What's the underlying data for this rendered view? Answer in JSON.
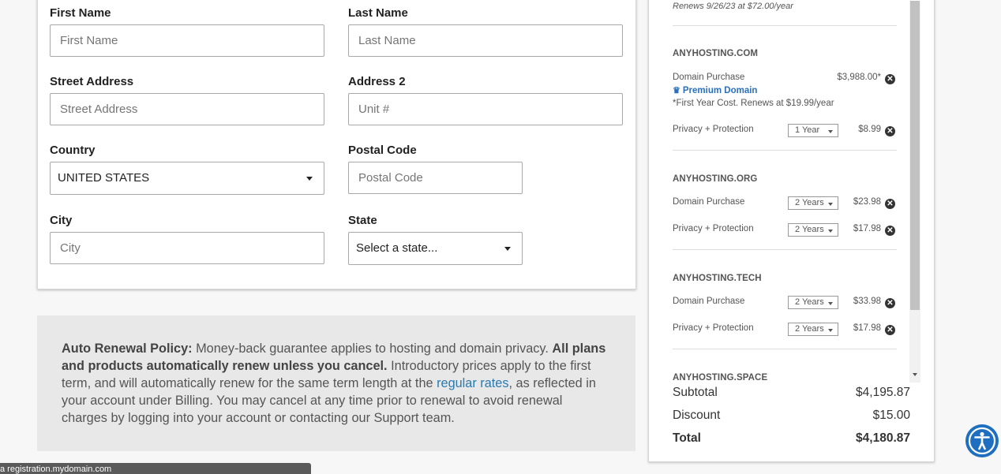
{
  "form": {
    "first_name": {
      "label": "First Name",
      "placeholder": "First Name"
    },
    "last_name": {
      "label": "Last Name",
      "placeholder": "Last Name"
    },
    "street": {
      "label": "Street Address",
      "placeholder": "Street Address"
    },
    "address2": {
      "label": "Address 2",
      "placeholder": "Unit #"
    },
    "country": {
      "label": "Country",
      "value": "UNITED STATES"
    },
    "postal": {
      "label": "Postal Code",
      "placeholder": "Postal Code"
    },
    "city": {
      "label": "City",
      "placeholder": "City"
    },
    "state": {
      "label": "State",
      "value": "Select a state..."
    }
  },
  "policy": {
    "title": "Auto Renewal Policy:",
    "text1": " Money-back guarantee applies to hosting and domain privacy. ",
    "bold": "All plans and products automatically renew unless you cancel.",
    "text2": " Introductory prices apply to the first term, and will automatically renew for the same term length at the ",
    "link": "regular rates",
    "text3": ", as reflected in your account under Billing. You may cancel at any time prior to renewal to avoid renewal charges by logging into your account or contacting our Support team."
  },
  "cart": {
    "renew_top": "Renews 9/26/23 at $72.00/year",
    "domains": [
      {
        "name": "ANYHOSTING.COM",
        "purchase_label": "Domain Purchase",
        "purchase_price": "$3,988.00*",
        "premium_label": "Premium Domain",
        "note": "*First Year Cost. Renews at $19.99/year",
        "privacy_label": "Privacy + Protection",
        "privacy_term": "1 Year",
        "privacy_price": "$8.99"
      },
      {
        "name": "ANYHOSTING.ORG",
        "purchase_label": "Domain Purchase",
        "purchase_term": "2 Years",
        "purchase_price": "$23.98",
        "privacy_label": "Privacy + Protection",
        "privacy_term": "2 Years",
        "privacy_price": "$17.98"
      },
      {
        "name": "ANYHOSTING.TECH",
        "purchase_label": "Domain Purchase",
        "purchase_term": "2 Years",
        "purchase_price": "$33.98",
        "privacy_label": "Privacy + Protection",
        "privacy_term": "2 Years",
        "privacy_price": "$17.98"
      },
      {
        "name": "ANYHOSTING.SPACE"
      }
    ],
    "subtotal_label": "Subtotal",
    "subtotal_value": "$4,195.87",
    "discount_label": "Discount",
    "discount_value": "$15.00",
    "total_label": "Total",
    "total_value": "$4,180.87"
  },
  "status_bar": "a registration.mydomain.com",
  "icons": {
    "remove": "remove-circle-icon",
    "crown": "crown-icon",
    "accessibility": "accessibility-icon"
  },
  "colors": {
    "link": "#2a7ab0",
    "premium": "#2a6fbd",
    "accessibility_bg": "#1e6fc0"
  }
}
